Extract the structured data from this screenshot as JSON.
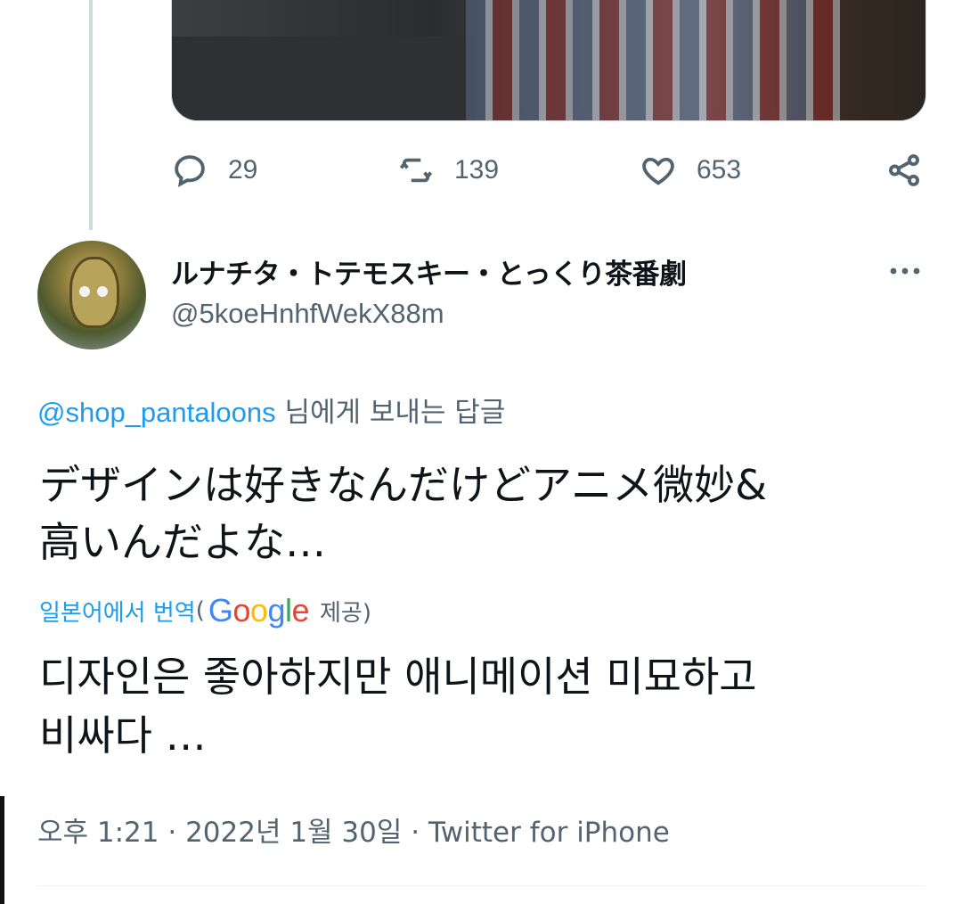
{
  "parent_tweet": {
    "stats": {
      "replies": "29",
      "retweets": "139",
      "likes": "653"
    }
  },
  "reply": {
    "display_name": "ルナチタ・トテモスキー・とっくり茶番劇",
    "handle": "@5koeHnhfWekX88m",
    "replying_to_mention": "@shop_pantaloons",
    "replying_to_suffix": " 님에게 보내는 답글",
    "text_line1": "デザインは好きなんだけどアニメ微妙&",
    "text_line2": "高いんだよな…",
    "translate_link": "일본어에서 번역",
    "translate_paren_open": "(",
    "translate_provider": "Google",
    "translate_suffix": "제공)",
    "translated_line1": "디자인은 좋아하지만 애니메이션 미묘하고",
    "translated_line2": "비싸다 …",
    "timestamp_meta": "오후 1:21 · 2022년 1월 30일 · Twitter for iPhone"
  },
  "icons": {
    "reply": "reply-icon",
    "retweet": "retweet-icon",
    "like": "heart-icon",
    "share": "share-icon",
    "more": "more-dots-icon"
  },
  "colors": {
    "accent": "#1d9bf0",
    "secondary_text": "#536471",
    "primary_text": "#0f1419",
    "google_blue": "#4285F4",
    "google_red": "#EA4335",
    "google_yellow": "#FBBC05",
    "google_green": "#34A853"
  }
}
